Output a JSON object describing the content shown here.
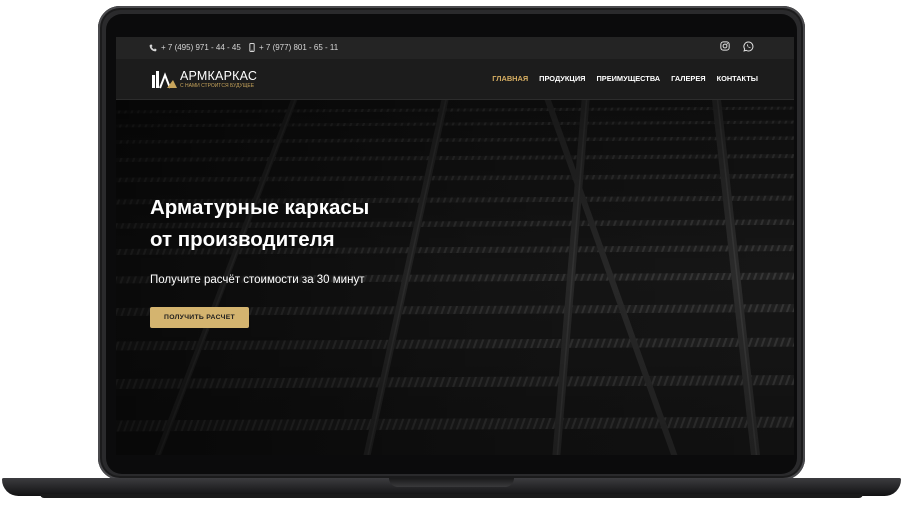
{
  "topbar": {
    "phone_1": "+ 7 (495) 971 - 44 - 45",
    "phone_2": "+ 7 (977) 801 - 65 - 11",
    "icons": [
      "phone-icon",
      "mobile-icon",
      "instagram-icon",
      "whatsapp-icon"
    ]
  },
  "header": {
    "logo_name": "АРМКАРКАС",
    "logo_tagline": "С НАМИ СТРОИТСЯ БУДУЩЕЕ",
    "nav": [
      {
        "label": "ГЛАВНАЯ",
        "active": true
      },
      {
        "label": "ПРОДУКЦИЯ",
        "active": false
      },
      {
        "label": "ПРЕИМУЩЕСТВА",
        "active": false
      },
      {
        "label": "ГАЛЕРЕЯ",
        "active": false
      },
      {
        "label": "КОНТАКТЫ",
        "active": false
      }
    ]
  },
  "hero": {
    "title_line_1": "Арматурные каркасы",
    "title_line_2": "от производителя",
    "subtitle": "Получите расчёт стоимости за 30 минут",
    "cta_label": "ПОЛУЧИТЬ РАСЧЕТ"
  },
  "colors": {
    "accent": "#d4b46f",
    "nav_active": "#d6ae62",
    "topbar_bg": "#242424",
    "navbar_bg": "#1c1c1c"
  }
}
